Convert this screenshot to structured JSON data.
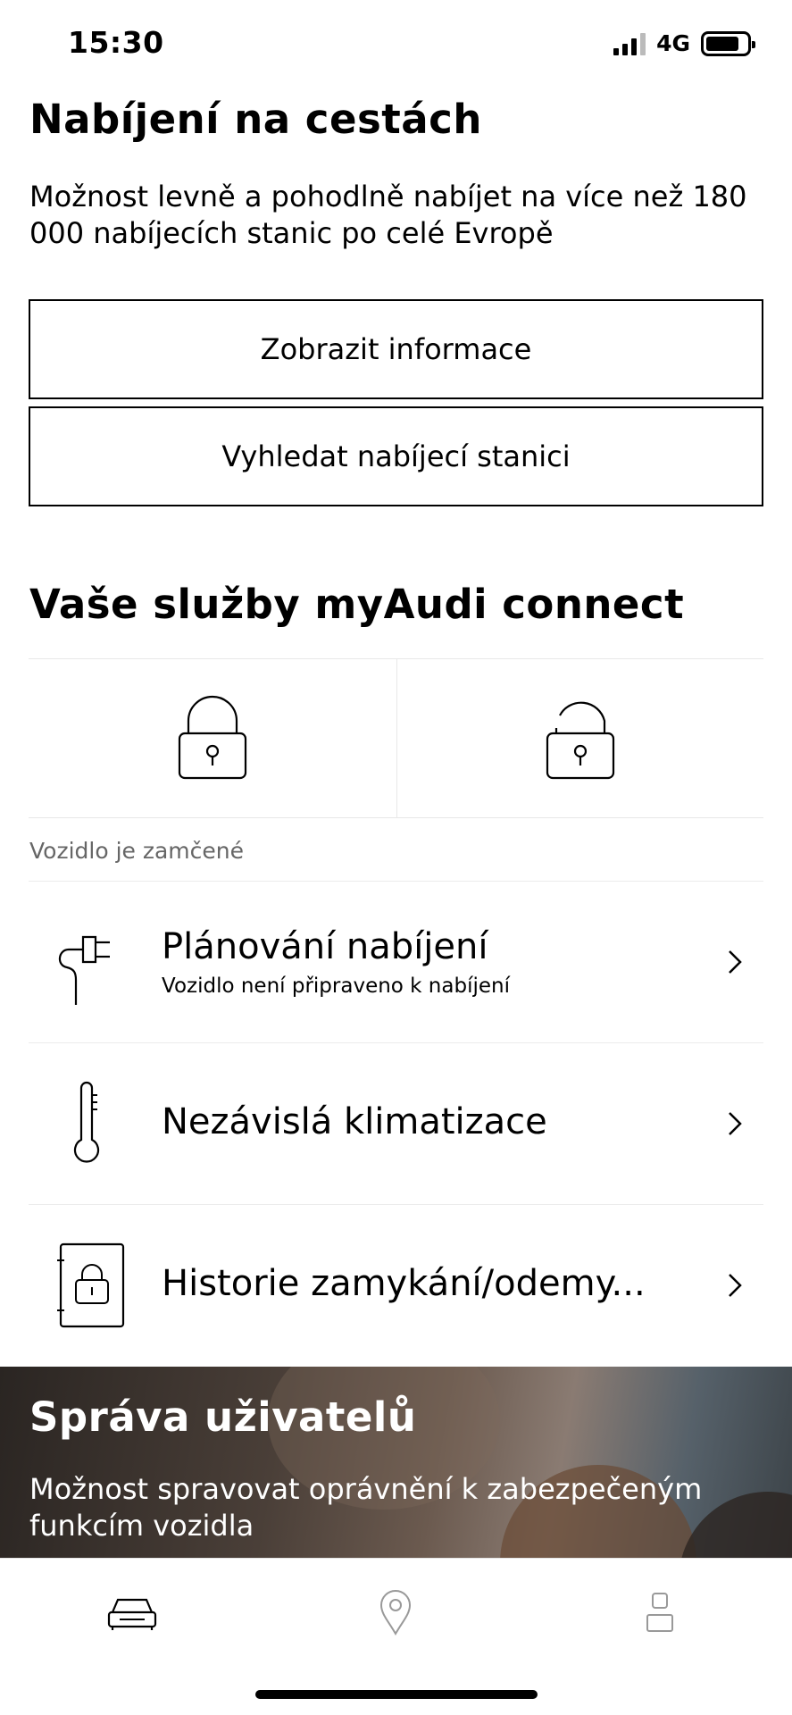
{
  "status_bar": {
    "time": "15:30",
    "network": "4G",
    "icons": [
      "signal-icon",
      "battery-icon"
    ]
  },
  "charging": {
    "title": "Nabíjení na cestách",
    "description": "Možnost levně a pohodlně nabíjet na více než 180 000 nabíjecích stanic po celé Evropě",
    "show_info_label": "Zobrazit informace",
    "find_station_label": "Vyhledat nabíjecí stanici"
  },
  "services": {
    "title": "Vaše služby myAudi connect",
    "lock_icons": [
      "lock-icon",
      "unlock-icon"
    ],
    "vehicle_status": "Vozidlo je zamčené",
    "items": [
      {
        "icon": "charging-plug-icon",
        "title": "Plánování nabíjení",
        "subtitle": "Vozidlo není připraveno k nabíjení"
      },
      {
        "icon": "thermometer-icon",
        "title": "Nezávislá klimatizace"
      },
      {
        "icon": "lock-history-icon",
        "title": "Historie zamykání/odemy..."
      }
    ]
  },
  "user_management": {
    "title": "Správa uživatelů",
    "description": "Možnost spravovat oprávnění k zabezpečeným funkcím vozidla"
  },
  "tab_bar": {
    "tabs": [
      {
        "icon": "car-icon",
        "active": true
      },
      {
        "icon": "map-pin-icon",
        "active": false
      },
      {
        "icon": "user-icon",
        "active": false
      }
    ]
  }
}
